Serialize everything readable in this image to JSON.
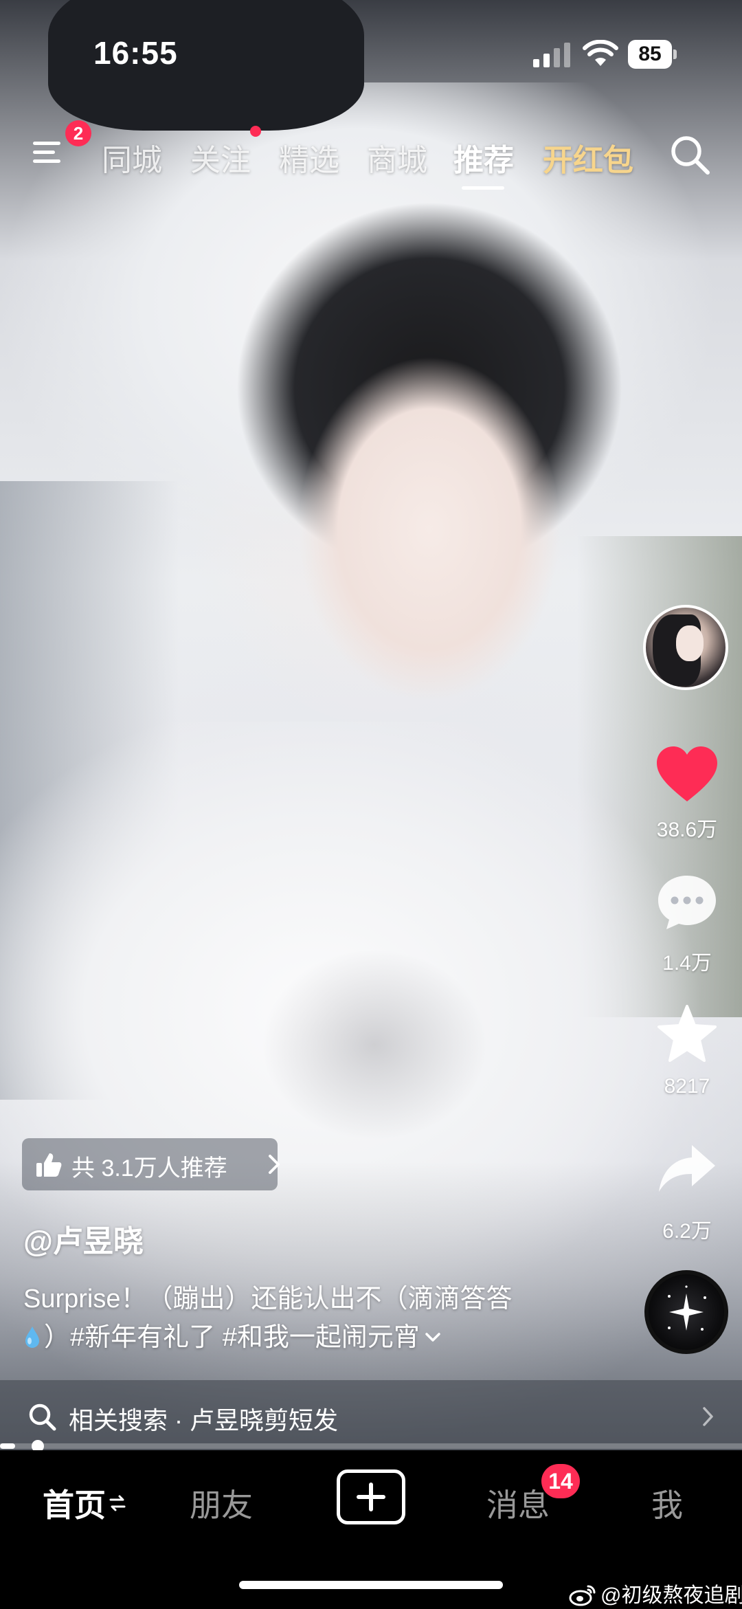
{
  "status_bar": {
    "time": "16:55",
    "battery": "85"
  },
  "top_nav": {
    "menu_badge": "2",
    "tabs": [
      {
        "label": "同城"
      },
      {
        "label": "关注"
      },
      {
        "label": "精选"
      },
      {
        "label": "商城"
      },
      {
        "label": "推荐"
      },
      {
        "label": "开红包"
      }
    ],
    "active_tab": "推荐"
  },
  "rail": {
    "likes": "38.6万",
    "comments": "1.4万",
    "favorites": "8217",
    "shares": "6.2万",
    "like_color": "#fe2c55"
  },
  "video": {
    "recommend_label": "共 3.1万人推荐",
    "author": "@卢昱晓",
    "caption_line1": "Surprise！（蹦出）还能认出不（滴滴答答",
    "caption_line2": "）#新年有礼了 #和我一起闹元宵",
    "progress": 0.02
  },
  "related_search": {
    "label": "相关搜索 · 卢昱晓剪短发"
  },
  "bottom_nav": {
    "home": "首页",
    "friends": "朋友",
    "messages": "消息",
    "messages_badge": "14",
    "me": "我"
  },
  "watermark": "@初级熬夜追剧",
  "colors": {
    "accent": "#fe2c55",
    "gold": "#f7d58c"
  }
}
